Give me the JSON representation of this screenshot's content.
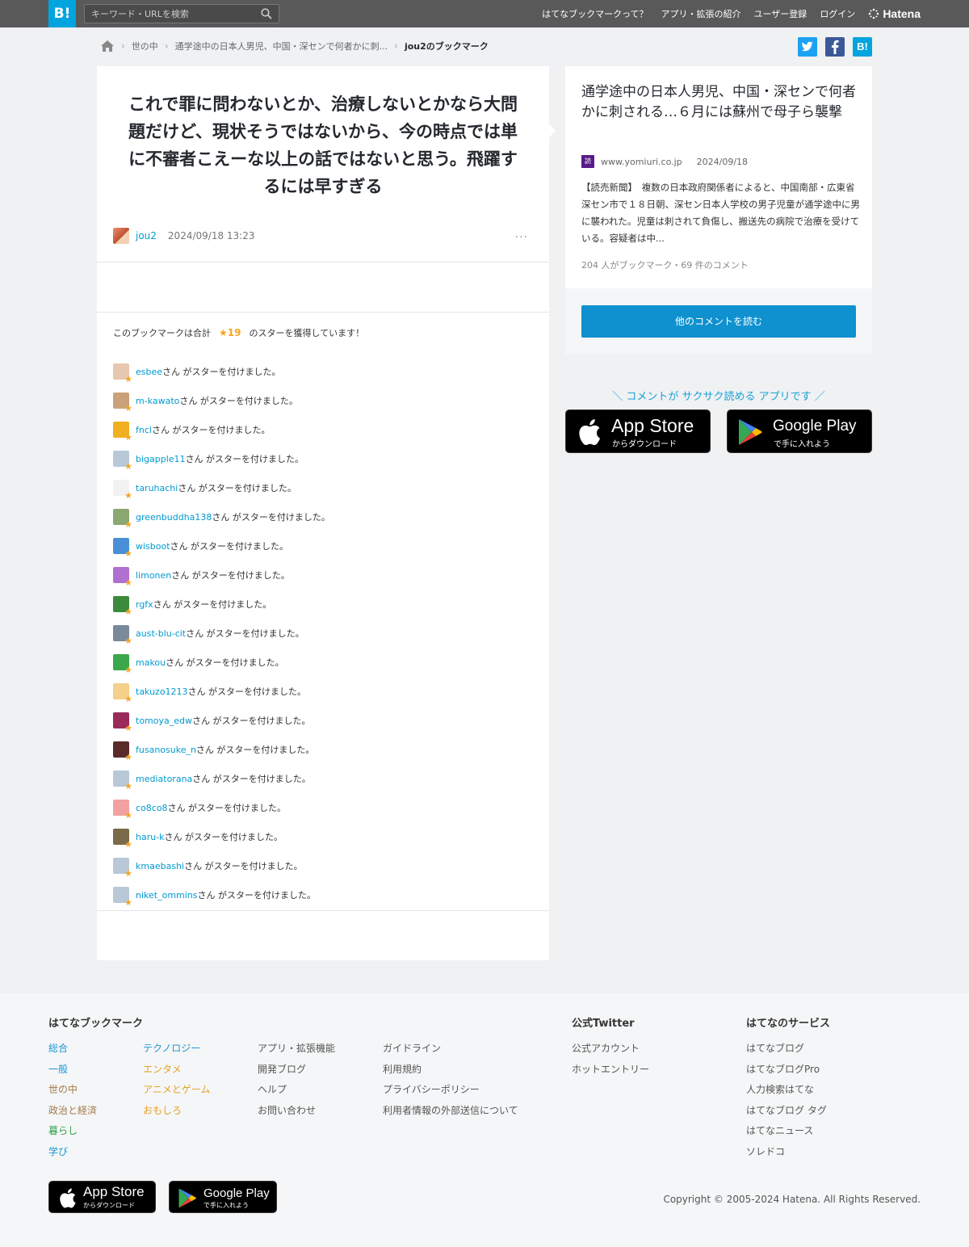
{
  "header": {
    "logo": "B!",
    "search_placeholder": "キーワード・URLを検索",
    "nav": [
      "はてなブックマークって？",
      "アプリ・拡張の紹介",
      "ユーザー登録",
      "ログイン"
    ],
    "brand": "Hatena"
  },
  "breadcrumb": {
    "category": "世の中",
    "entry": "通学途中の日本人男児、中国・深センで何者かに刺...",
    "current": "jou2のブックマーク"
  },
  "share": {
    "twitter": "t",
    "facebook": "f",
    "hatena": "B!"
  },
  "bookmark": {
    "comment": "これで罪に問わないとか、治療しないとかなら大問題だけど、現状そうではないから、今の時点では単に不審者こえーな以上の話ではないと思う。飛躍するには早すぎる",
    "user": "jou2",
    "datetime": "2024/09/18 13:23",
    "more": "···",
    "star_prefix": "このブックマークは合計",
    "star_total": "★19",
    "star_suffix": "のスターを獲得しています！",
    "star_suffix_text": "さん がスターを付けました。",
    "stars": [
      {
        "user": "esbee",
        "suffix": "さん がスターを付けました。"
      },
      {
        "user": "m-kawato",
        "suffix": "さん がスターを付けました。"
      },
      {
        "user": "fncl",
        "suffix": "さん がスターを付けました。"
      },
      {
        "user": "bigapple11",
        "suffix": "さん がスターを付けました。"
      },
      {
        "user": "taruhachi",
        "suffix": "さん がスターを付けました。"
      },
      {
        "user": "greenbuddha138",
        "suffix": "さん がスターを付けました。"
      },
      {
        "user": "wisboot",
        "suffix": "さん がスターを付けました。"
      },
      {
        "user": "limonen",
        "suffix": "さん がスターを付けました。"
      },
      {
        "user": "rgfx",
        "suffix": "さん がスターを付けました。"
      },
      {
        "user": "aust-blu-cit",
        "suffix": "さん がスターを付けました。"
      },
      {
        "user": "makou",
        "suffix": "さん がスターを付けました。"
      },
      {
        "user": "takuzo1213",
        "suffix": "さん がスターを付けました。"
      },
      {
        "user": "tomoya_edw",
        "suffix": "さん がスターを付けました。"
      },
      {
        "user": "fusanosuke_n",
        "suffix": "さん がスターを付けました。"
      },
      {
        "user": "mediatorana",
        "suffix": "さん がスターを付けました。"
      },
      {
        "user": "co8co8",
        "suffix": "さん がスターを付けました。"
      },
      {
        "user": "haru-k",
        "suffix": "さん がスターを付けました。"
      },
      {
        "user": "kmaebashi",
        "suffix": "さん がスターを付けました。"
      },
      {
        "user": "niket_ommins",
        "suffix": "さん がスターを付けました。"
      }
    ]
  },
  "entry": {
    "title": "通学途中の日本人男児、中国・深センで何者かに刺される…６月には蘇州で母子ら襲撃",
    "favicon_text": "読",
    "domain": "www.yomiuri.co.jp",
    "date": "2024/09/18",
    "summary": "【読売新聞】　複数の日本政府関係者によると、中国南部・広東省深セン市で１８日朝、深セン日本人学校の男子児童が通学途中に男に襲われた。児童は刺されて負傷し、搬送先の病院で治療を受けている。容疑者は中...",
    "stats": "204 人がブックマーク・69 件のコメント",
    "read_button": "他のコメントを読む"
  },
  "app_promo": {
    "tagline": "＼ コメントが サクサク読める アプリです ／",
    "appstore_name": "App Store",
    "appstore_sub": "からダウンロード",
    "googleplay_name": "Google Play",
    "googleplay_sub": "で手に入れよう"
  },
  "footer": {
    "col1_head": "はてなブックマーク",
    "categories_a": [
      "総合",
      "一般",
      "世の中",
      "政治と経済",
      "暮らし",
      "学び"
    ],
    "categories_b": [
      "テクノロジー",
      "エンタメ",
      "アニメとゲーム",
      "おもしろ"
    ],
    "links_a": [
      "アプリ・拡張機能",
      "開発ブログ",
      "ヘルプ",
      "お問い合わせ"
    ],
    "links_b": [
      "ガイドライン",
      "利用規約",
      "プライバシーポリシー",
      "利用者情報の外部送信について"
    ],
    "twitter_head": "公式Twitter",
    "twitter_links": [
      "公式アカウント",
      "ホットエントリー"
    ],
    "services_head": "はてなのサービス",
    "services": [
      "はてなブログ",
      "はてなブログPro",
      "人力検索はてな",
      "はてなブログ タグ",
      "はてなニュース",
      "ソレドコ"
    ],
    "copyright": "Copyright © 2005-2024 Hatena. All Rights Reserved."
  },
  "colors": {
    "topbar": "#595959",
    "accent_blue": "#00a4de",
    "button_blue": "#0f91cf",
    "star": "#f5a623",
    "link": "#009ad0"
  },
  "avatar_colors": [
    "#e8c7b0",
    "#c9a27a",
    "#f0b020",
    "#b8c8d8",
    "#f2f2f2",
    "#8aa870",
    "#4a90d9",
    "#b070d0",
    "#3c8a3c",
    "#7a8a9a",
    "#3aa84a",
    "#f5d08a",
    "#9a2a5a",
    "#5a2a2a",
    "#b8c8d8",
    "#f2a0a0",
    "#7a6a4a",
    "#b8c8d8",
    "#b8c8d8"
  ]
}
